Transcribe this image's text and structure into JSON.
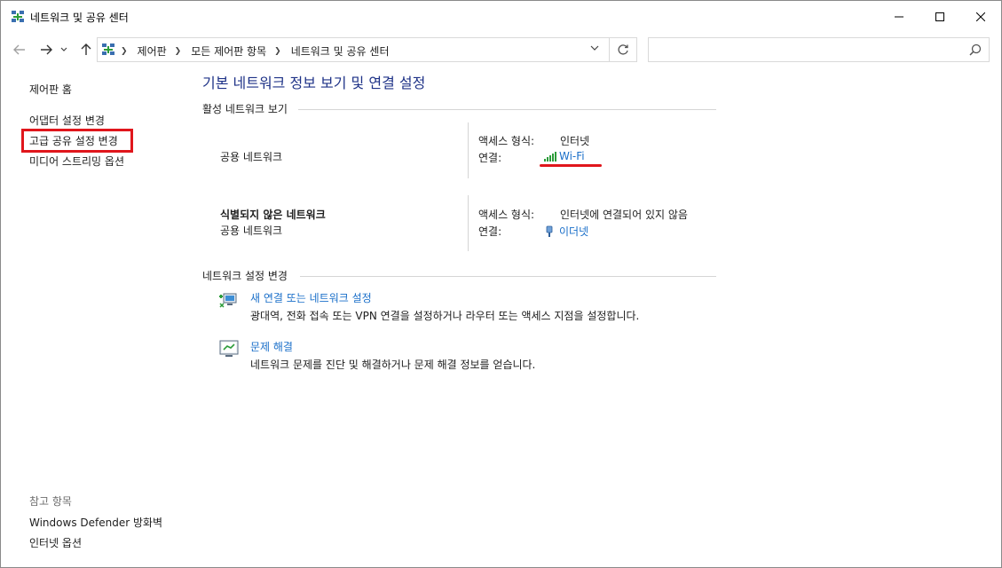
{
  "window": {
    "title": "네트워크 및 공유 센터"
  },
  "nav": {
    "breadcrumbs": [
      "제어판",
      "모든 제어판 항목",
      "네트워크 및 공유 센터"
    ],
    "search_placeholder": ""
  },
  "sidebar": {
    "links": [
      {
        "label": "제어판 홈"
      },
      {
        "label": "어댑터 설정 변경"
      },
      {
        "label": "고급 공유 설정 변경"
      },
      {
        "label": "미디어 스트리밍 옵션"
      }
    ],
    "see_also_heading": "참고 항목",
    "see_also": [
      {
        "label": "Windows Defender 방화벽"
      },
      {
        "label": "인터넷 옵션"
      }
    ]
  },
  "main": {
    "title": "기본 네트워크 정보 보기 및 연결 설정",
    "active_section": "활성 네트워크 보기",
    "networks": [
      {
        "name": "",
        "category": "공용 네트워크",
        "access_label": "액세스 형식:",
        "access_value": "인터넷",
        "connection_label": "연결:",
        "connection_value": "Wi-Fi",
        "connection_icon": "wifi-signal-icon"
      },
      {
        "name": "식별되지 않은 네트워크",
        "category": "공용 네트워크",
        "access_label": "액세스 형식:",
        "access_value": "인터넷에 연결되어 있지 않음",
        "connection_label": "연결:",
        "connection_value": "이더넷",
        "connection_icon": "ethernet-plug-icon"
      }
    ],
    "change_section": "네트워크 설정 변경",
    "tasks": [
      {
        "title": "새 연결 또는 네트워크 설정",
        "description": "광대역, 전화 접속 또는 VPN 연결을 설정하거나 라우터 또는 액세스 지점을 설정합니다.",
        "icon": "new-connection-icon"
      },
      {
        "title": "문제 해결",
        "description": "네트워크 문제를 진단 및 해결하거나 문제 해결 정보를 얻습니다.",
        "icon": "troubleshoot-icon"
      }
    ]
  },
  "colors": {
    "title_blue": "#1e3287",
    "link_blue": "#1a6fc9",
    "highlight_red": "#e0161c"
  }
}
